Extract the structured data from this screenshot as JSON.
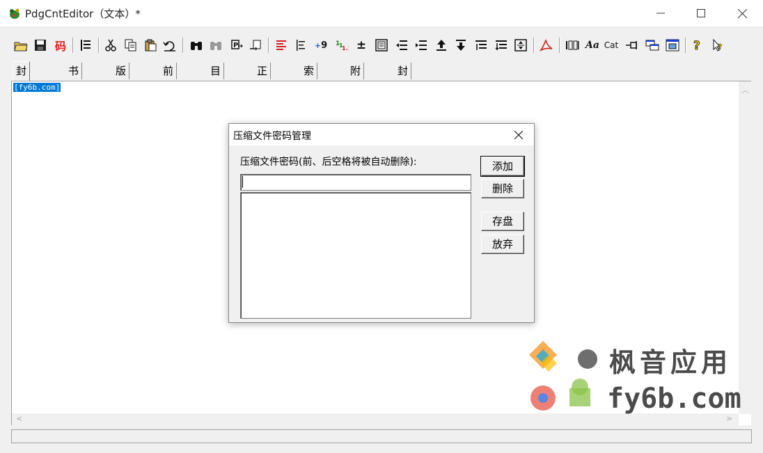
{
  "window": {
    "title": "PdgCntEditor（文本）*"
  },
  "toolbar": {
    "code_label": "码",
    "num_label": "9",
    "cat_label": "Cat",
    "italic_label": "Aa"
  },
  "tabs": [
    {
      "label": "封面页+",
      "active": true
    },
    {
      "label": "书名页"
    },
    {
      "label": "版权页"
    },
    {
      "label": "前言页"
    },
    {
      "label": "目录页"
    },
    {
      "label": "正文页"
    },
    {
      "label": "索引页"
    },
    {
      "label": "附录页"
    },
    {
      "label": "封底页"
    }
  ],
  "editor": {
    "selected_text": "[fy6b.com]"
  },
  "dialog": {
    "title": "压缩文件密码管理",
    "label": "压缩文件密码(前、后空格将被自动删除):",
    "input_value": "",
    "buttons": {
      "add": "添加",
      "delete": "删除",
      "save": "存盘",
      "discard": "放弃"
    }
  },
  "watermark": {
    "cn_text": "枫音应用",
    "url": "fy6b.com"
  },
  "colors": {
    "selection": "#0078d7",
    "code_red": "#e02020"
  }
}
